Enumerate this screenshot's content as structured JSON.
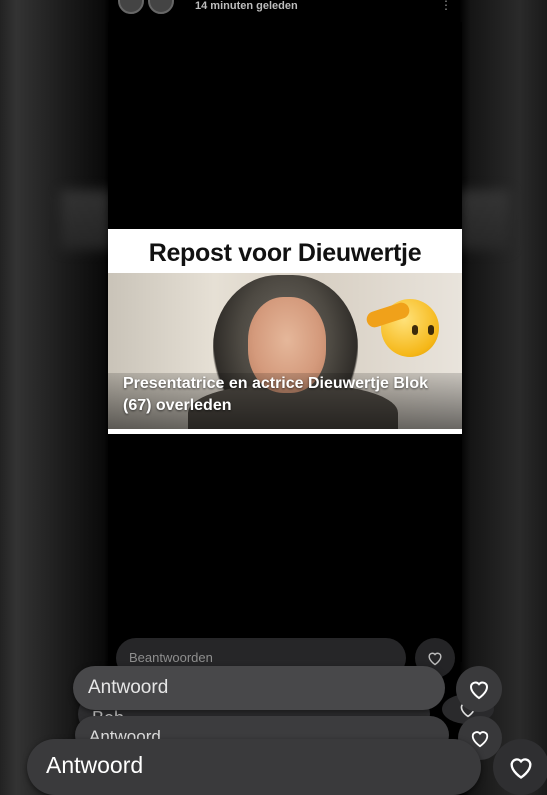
{
  "story": {
    "time_ago": "14 minuten geleden",
    "post": {
      "title": "Repost voor Dieuwertje",
      "caption": "Presentatrice en actrice Dieuwertje Blok (67) overleden",
      "emoji": "saluting-face"
    }
  },
  "reply_stack": {
    "layer1_label": "Beantwoorden",
    "layer2_label": "Antwoord",
    "layer3_label": "Beh",
    "layer4_label": "Antwoord",
    "layer5_label": "Antwoord"
  },
  "colors": {
    "background": "#000000",
    "pill": "#3a3a3c",
    "heart_stroke": "#ffffff"
  }
}
